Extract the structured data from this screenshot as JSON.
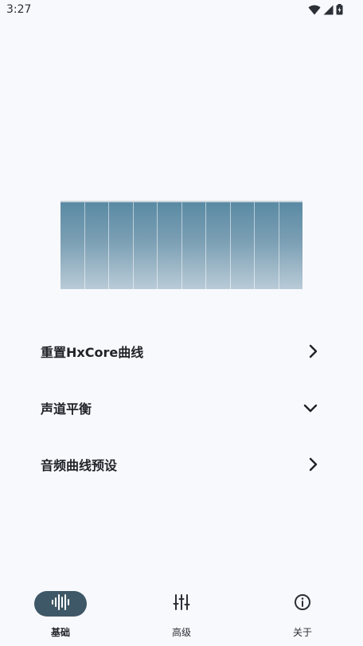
{
  "status_bar": {
    "time": "3:27",
    "icons": [
      "wifi-icon",
      "cellular-signal-icon",
      "battery-charging-icon"
    ]
  },
  "equalizer": {
    "band_count": 10
  },
  "menu": [
    {
      "label": "重置HxCore曲线",
      "icon": "chevron-right-icon"
    },
    {
      "label": "声道平衡",
      "icon": "chevron-down-icon"
    },
    {
      "label": "音频曲线预设",
      "icon": "chevron-right-icon"
    }
  ],
  "bottom_nav": {
    "selected": 0,
    "items": [
      {
        "label": "基础",
        "icon": "waveform-icon"
      },
      {
        "label": "高级",
        "icon": "sliders-icon"
      },
      {
        "label": "关于",
        "icon": "info-icon"
      }
    ]
  },
  "colors": {
    "background": "#f8f9fd",
    "active_nav": "#3f5867",
    "eq_top": "#5a8aa4",
    "eq_bottom": "#b9cbd7"
  }
}
